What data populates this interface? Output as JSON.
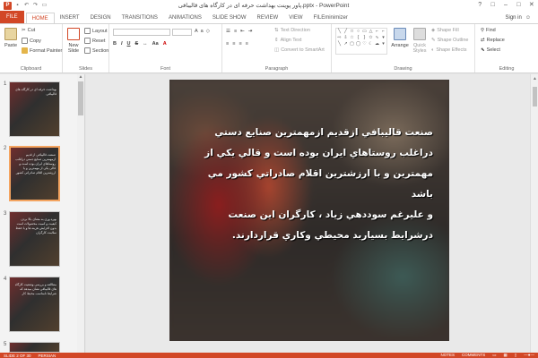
{
  "window": {
    "title": "پاور پوینت بهداشت حرفه ای در کارگاه های قالیبافی.pptx - PowerPoint",
    "app_logo": "P",
    "controls": [
      "?",
      "□",
      "–",
      "□",
      "✕"
    ]
  },
  "tabs": [
    "FILE",
    "HOME",
    "INSERT",
    "DESIGN",
    "TRANSITIONS",
    "ANIMATIONS",
    "SLIDE SHOW",
    "REVIEW",
    "VIEW",
    "FILEminimizer"
  ],
  "active_tab": "HOME",
  "signin": "Sign in",
  "ribbon": {
    "clipboard": {
      "label": "Clipboard",
      "paste": "Paste",
      "cut": "Cut",
      "copy": "Copy",
      "format_painter": "Format Painter"
    },
    "slides": {
      "label": "Slides",
      "new_slide": "New Slide",
      "layout": "Layout",
      "reset": "Reset",
      "section": "Section"
    },
    "font": {
      "label": "Font"
    },
    "paragraph": {
      "label": "Paragraph",
      "text_direction": "Text Direction",
      "align_text": "Align Text",
      "convert_smartart": "Convert to SmartArt"
    },
    "drawing": {
      "label": "Drawing",
      "arrange": "Arrange",
      "quick_styles": "Quick Styles",
      "shape_fill": "Shape Fill",
      "shape_outline": "Shape Outline",
      "shape_effects": "Shape Effects"
    },
    "editing": {
      "label": "Editing",
      "find": "Find",
      "replace": "Replace",
      "select": "Select"
    }
  },
  "thumbnails": [
    {
      "num": "1",
      "text": "بهداشت حرفه ای در کارگاه های قالیبافی"
    },
    {
      "num": "2",
      "text": "صنعت قالیبافی از قدیم ازمهمترین صنایع دستی دراغلب روستاهای ایران بوده است و قالی یکی از مهمترین و با ارزشترین اقلام صادراتی کشور"
    },
    {
      "num": "3",
      "text": "بهره وری به معنای بالا بردن کیفیت و کمیت محصولات است بدون افزایش هزینه ها و با حفظ سلامت کارگران"
    },
    {
      "num": "4",
      "text": "مطالعه و بررسی وضعیت کارگاه های قالیبافی نشان میدهد که شرایط نامناسب محیط کار"
    },
    {
      "num": "5",
      "text": ""
    }
  ],
  "slide": {
    "lines": [
      "صنعت قاليبافي ازقديم ازمهمترين صنايع دستي",
      "دراغلب روستاهاي ايران بوده   است و قالي يکي از",
      "مهمترين و با ارزشترين اقلام صادراتي کشور مي باشد",
      "و  عليرغم  سوددهي زياد ،  کارگران اين صنعت",
      "درشرايط بسياربد محيطي وکاري قراردارند."
    ]
  },
  "status": {
    "slide_info": "SLIDE 2 OF 30",
    "language": "PERSIAN",
    "notes": "NOTES",
    "comments": "COMMENTS"
  }
}
